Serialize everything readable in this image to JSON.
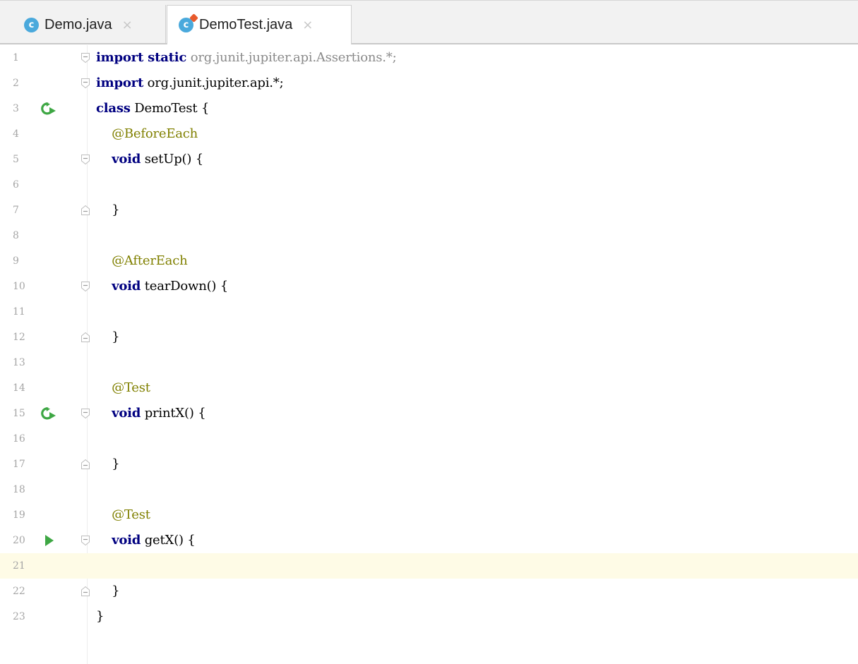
{
  "tabs": [
    {
      "label": "Demo.java",
      "icon": "class-icon",
      "icon_letter": "c",
      "active": false
    },
    {
      "label": "DemoTest.java",
      "icon": "test-class-icon",
      "icon_letter": "c",
      "active": true
    }
  ],
  "tab_close_glyph": "×",
  "colors": {
    "keyword": "#000080",
    "annotation": "#808000",
    "unused_import": "#8a8a8a",
    "caret_line": "#fefbe6",
    "run_icon": "#3ea744"
  },
  "editor": {
    "caret_line": 21,
    "lines": [
      {
        "n": "1",
        "run": "",
        "fold": "start",
        "tokens": [
          {
            "t": "import static",
            "c": "kw"
          },
          {
            "t": " org.junit.jupiter.api.Assertions.*;",
            "c": "dim"
          }
        ]
      },
      {
        "n": "2",
        "run": "",
        "fold": "start",
        "tokens": [
          {
            "t": "import",
            "c": "kw"
          },
          {
            "t": " org.junit.jupiter.api.*;",
            "c": "ident"
          }
        ]
      },
      {
        "n": "3",
        "run": "rerun",
        "fold": "",
        "tokens": [
          {
            "t": "class",
            "c": "kw"
          },
          {
            "t": " DemoTest {",
            "c": "ident"
          }
        ]
      },
      {
        "n": "4",
        "run": "",
        "fold": "",
        "tokens": [
          {
            "t": "    @BeforeEach",
            "c": "ann"
          }
        ]
      },
      {
        "n": "5",
        "run": "",
        "fold": "start",
        "tokens": [
          {
            "t": "    ",
            "c": "ident"
          },
          {
            "t": "void",
            "c": "kw"
          },
          {
            "t": " setUp() {",
            "c": "ident"
          }
        ]
      },
      {
        "n": "6",
        "run": "",
        "fold": "",
        "tokens": []
      },
      {
        "n": "7",
        "run": "",
        "fold": "end",
        "tokens": [
          {
            "t": "    }",
            "c": "ident"
          }
        ]
      },
      {
        "n": "8",
        "run": "",
        "fold": "",
        "tokens": []
      },
      {
        "n": "9",
        "run": "",
        "fold": "",
        "tokens": [
          {
            "t": "    @AfterEach",
            "c": "ann"
          }
        ]
      },
      {
        "n": "10",
        "run": "",
        "fold": "start",
        "tokens": [
          {
            "t": "    ",
            "c": "ident"
          },
          {
            "t": "void",
            "c": "kw"
          },
          {
            "t": " tearDown() {",
            "c": "ident"
          }
        ]
      },
      {
        "n": "11",
        "run": "",
        "fold": "",
        "tokens": []
      },
      {
        "n": "12",
        "run": "",
        "fold": "end",
        "tokens": [
          {
            "t": "    }",
            "c": "ident"
          }
        ]
      },
      {
        "n": "13",
        "run": "",
        "fold": "",
        "tokens": []
      },
      {
        "n": "14",
        "run": "",
        "fold": "",
        "tokens": [
          {
            "t": "    @Test",
            "c": "ann"
          }
        ]
      },
      {
        "n": "15",
        "run": "rerun",
        "fold": "start",
        "tokens": [
          {
            "t": "    ",
            "c": "ident"
          },
          {
            "t": "void",
            "c": "kw"
          },
          {
            "t": " printX() {",
            "c": "ident"
          }
        ]
      },
      {
        "n": "16",
        "run": "",
        "fold": "",
        "tokens": []
      },
      {
        "n": "17",
        "run": "",
        "fold": "end",
        "tokens": [
          {
            "t": "    }",
            "c": "ident"
          }
        ]
      },
      {
        "n": "18",
        "run": "",
        "fold": "",
        "tokens": []
      },
      {
        "n": "19",
        "run": "",
        "fold": "",
        "tokens": [
          {
            "t": "    @Test",
            "c": "ann"
          }
        ]
      },
      {
        "n": "20",
        "run": "play",
        "fold": "start",
        "tokens": [
          {
            "t": "    ",
            "c": "ident"
          },
          {
            "t": "void",
            "c": "kw"
          },
          {
            "t": " getX() {",
            "c": "ident"
          }
        ]
      },
      {
        "n": "21",
        "run": "",
        "fold": "",
        "tokens": []
      },
      {
        "n": "22",
        "run": "",
        "fold": "end",
        "tokens": [
          {
            "t": "    }",
            "c": "ident"
          }
        ]
      },
      {
        "n": "23",
        "run": "",
        "fold": "",
        "tokens": [
          {
            "t": "}",
            "c": "ident"
          }
        ]
      }
    ]
  }
}
